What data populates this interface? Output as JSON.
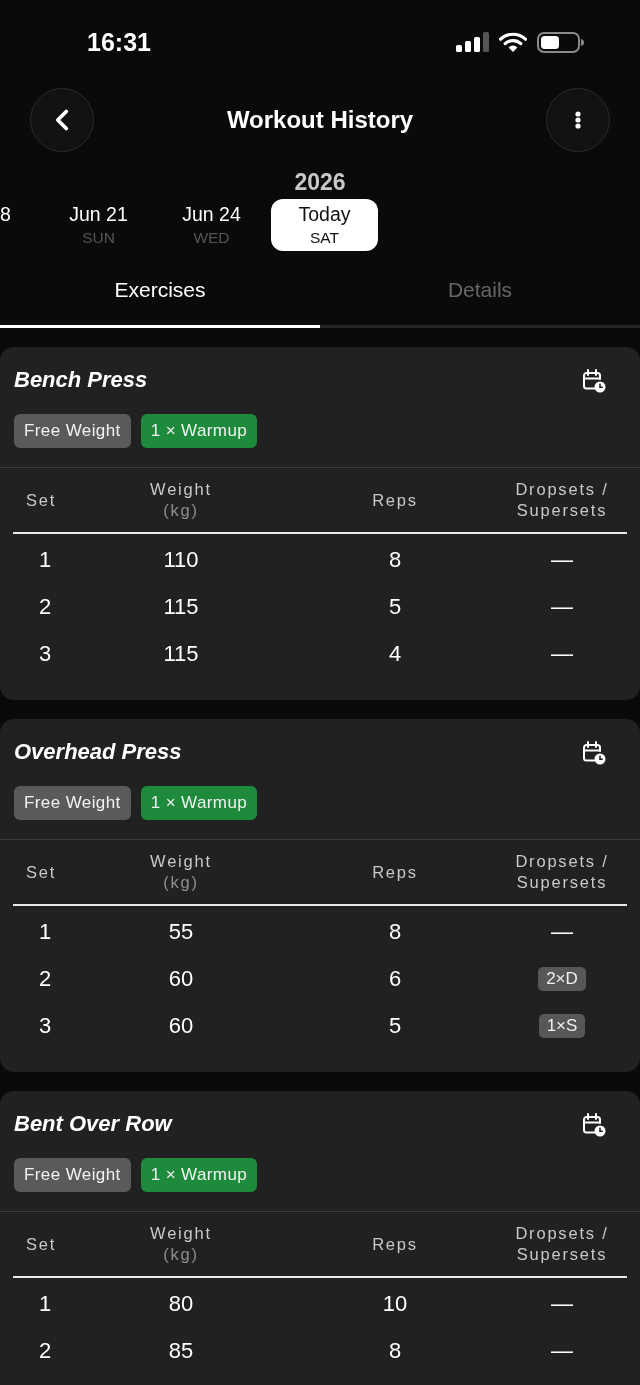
{
  "status_bar": {
    "time": "16:31"
  },
  "header": {
    "title": "Workout History"
  },
  "date_strip": {
    "year": "2026",
    "dates": [
      {
        "date": "8",
        "selected": false
      },
      {
        "date": "Jun 21",
        "weekday": "SUN",
        "selected": false
      },
      {
        "date": "Jun 24",
        "weekday": "WED",
        "selected": false
      },
      {
        "date": "Today",
        "weekday": "SAT",
        "selected": true
      }
    ]
  },
  "tabs": [
    {
      "label": "Exercises",
      "selected": true
    },
    {
      "label": "Details",
      "selected": false
    }
  ],
  "exercises": [
    {
      "name": "Bench Press",
      "tags": [
        {
          "label": "Free Weight",
          "color": "#5a5a5a"
        },
        {
          "label": "1 × Warmup",
          "color": "#1e8a3c"
        }
      ],
      "columns": [
        {
          "label": "Set"
        },
        {
          "label": "Weight",
          "unit": "(kg)"
        },
        {
          "label": "Reps"
        },
        {
          "label": "Dropsets / Supersets"
        }
      ],
      "rows": [
        {
          "set": "1",
          "weight": "110",
          "reps": "8",
          "extra": {
            "kind": "dash",
            "text": "—"
          }
        },
        {
          "set": "2",
          "weight": "115",
          "reps": "5",
          "extra": {
            "kind": "dash",
            "text": "—"
          }
        },
        {
          "set": "3",
          "weight": "115",
          "reps": "4",
          "extra": {
            "kind": "dash",
            "text": "—"
          }
        }
      ]
    },
    {
      "name": "Overhead Press",
      "tags": [
        {
          "label": "Free Weight",
          "color": "#5a5a5a"
        },
        {
          "label": "1 × Warmup",
          "color": "#1e8a3c"
        }
      ],
      "columns": [
        {
          "label": "Set"
        },
        {
          "label": "Weight",
          "unit": "(kg)"
        },
        {
          "label": "Reps"
        },
        {
          "label": "Dropsets / Supersets"
        }
      ],
      "rows": [
        {
          "set": "1",
          "weight": "55",
          "reps": "8",
          "extra": {
            "kind": "dash",
            "text": "—"
          }
        },
        {
          "set": "2",
          "weight": "60",
          "reps": "6",
          "extra": {
            "kind": "badge",
            "text": "2×D"
          }
        },
        {
          "set": "3",
          "weight": "60",
          "reps": "5",
          "extra": {
            "kind": "badge",
            "text": "1×S"
          }
        }
      ]
    },
    {
      "name": "Bent Over Row",
      "tags": [
        {
          "label": "Free Weight",
          "color": "#5a5a5a"
        },
        {
          "label": "1 × Warmup",
          "color": "#1e8a3c"
        }
      ],
      "columns": [
        {
          "label": "Set"
        },
        {
          "label": "Weight",
          "unit": "(kg)"
        },
        {
          "label": "Reps"
        },
        {
          "label": "Dropsets / Supersets"
        }
      ],
      "rows": [
        {
          "set": "1",
          "weight": "80",
          "reps": "10",
          "extra": {
            "kind": "dash",
            "text": "—"
          }
        },
        {
          "set": "2",
          "weight": "85",
          "reps": "8",
          "extra": {
            "kind": "dash",
            "text": "—"
          }
        }
      ]
    }
  ]
}
